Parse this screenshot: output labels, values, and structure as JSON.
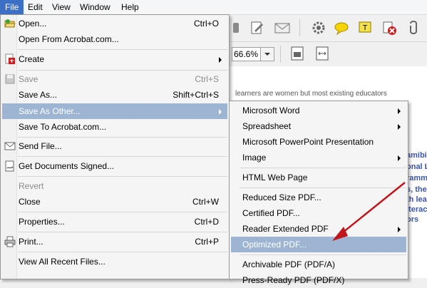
{
  "menubar": {
    "items": [
      "File",
      "Edit",
      "View",
      "Window",
      "Help"
    ]
  },
  "toolbar": {
    "zoom_value": "66.6%"
  },
  "document": {
    "line1": "learners are women but most existing educators",
    "side_fragments": [
      "amibi",
      "onal L",
      "ramm",
      "s, the",
      "th lea",
      "iteracy",
      "ors"
    ]
  },
  "file_menu": {
    "items": [
      {
        "label": "Open...",
        "shortcut": "Ctrl+O",
        "icon": "open-folder-icon",
        "disabled": false
      },
      {
        "label": "Open From Acrobat.com...",
        "shortcut": "",
        "disabled": false
      },
      {
        "label": "Create",
        "shortcut": "",
        "icon": "create-pdf-icon",
        "submenu": true,
        "disabled": false
      },
      {
        "label": "Save",
        "shortcut": "Ctrl+S",
        "icon": "save-icon",
        "disabled": true
      },
      {
        "label": "Save As...",
        "shortcut": "Shift+Ctrl+S",
        "disabled": false
      },
      {
        "label": "Save As Other...",
        "shortcut": "",
        "submenu": true,
        "highlighted": true
      },
      {
        "label": "Save To Acrobat.com...",
        "shortcut": ""
      },
      {
        "label": "Send File...",
        "shortcut": "",
        "icon": "envelope-icon"
      },
      {
        "label": "Get Documents Signed...",
        "shortcut": "",
        "icon": "sign-icon"
      },
      {
        "label": "Revert",
        "shortcut": "",
        "disabled": true
      },
      {
        "label": "Close",
        "shortcut": "Ctrl+W"
      },
      {
        "label": "Properties...",
        "shortcut": "Ctrl+D"
      },
      {
        "label": "Print...",
        "shortcut": "Ctrl+P",
        "icon": "printer-icon"
      },
      {
        "label": "View All Recent Files...",
        "shortcut": ""
      }
    ]
  },
  "save_as_other_menu": {
    "items": [
      {
        "label": "Microsoft Word",
        "submenu": true
      },
      {
        "label": "Spreadsheet",
        "submenu": true
      },
      {
        "label": "Microsoft PowerPoint Presentation"
      },
      {
        "label": "Image",
        "submenu": true
      },
      {
        "label": "HTML Web Page"
      },
      {
        "label": "Reduced Size PDF..."
      },
      {
        "label": "Certified PDF..."
      },
      {
        "label": "Reader Extended PDF",
        "submenu": true
      },
      {
        "label": "Optimized PDF...",
        "highlighted": true
      },
      {
        "label": "Archivable PDF (PDF/A)"
      },
      {
        "label": "Press-Ready PDF (PDF/X)"
      }
    ]
  },
  "colors": {
    "menu_highlight": "#9db5d2",
    "menubar_active": "#3d6fc6",
    "annotation_arrow": "#c0171c"
  }
}
